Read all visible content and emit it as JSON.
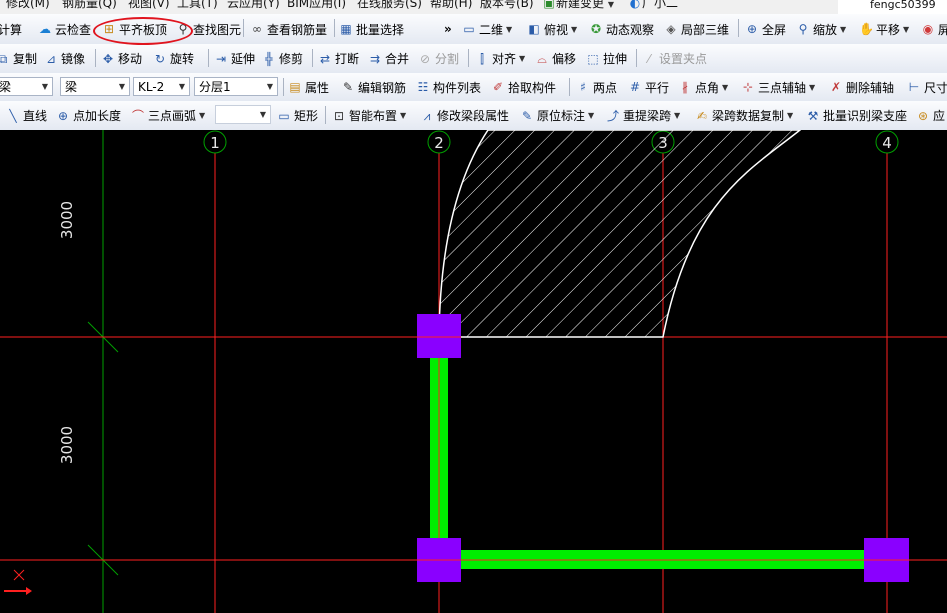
{
  "menubar": {
    "items": [
      "修改(M)",
      "钢筋量(Q)",
      "视图(V)",
      "工具(T)",
      "云应用(Y)",
      "BIM应用(I)",
      "在线服务(S)",
      "帮助(H)",
      "版本号(B)",
      "新建变更",
      "广小二"
    ],
    "user": "fengc50399"
  },
  "toolbar1": {
    "items": [
      "汇总计算",
      "云检查",
      "平齐板顶",
      "查找图元",
      "查看钢筋量",
      "批量选择",
      "二维",
      "俯视",
      "动态观察",
      "局部三维",
      "全屏",
      "缩放",
      "平移",
      "屏"
    ]
  },
  "toolbar2": {
    "items": [
      "复制",
      "镜像",
      "移动",
      "旋转",
      "延伸",
      "修剪",
      "打断",
      "合并",
      "分割",
      "对齐",
      "偏移",
      "拉伸",
      "设置夹点"
    ]
  },
  "toolbar3": {
    "combo_type": "梁",
    "combo_category": "梁",
    "combo_component": "KL-2",
    "combo_layer": "分层1",
    "items": [
      "属性",
      "编辑钢筋",
      "构件列表",
      "拾取构件",
      "两点",
      "平行",
      "点角",
      "三点辅轴",
      "删除辅轴",
      "尺寸"
    ]
  },
  "toolbar4": {
    "items": [
      "直线",
      "点加长度",
      "三点画弧",
      "矩形",
      "智能布置",
      "修改梁段属性",
      "原位标注",
      "重提梁跨",
      "梁跨数据复制",
      "批量识别梁支座",
      "应"
    ]
  },
  "canvas": {
    "axis_labels": [
      "1",
      "2",
      "3",
      "4"
    ],
    "dimension_labels": [
      "3000",
      "3000"
    ],
    "colors": {
      "background": "#000000",
      "axis_line": "#ff2020",
      "dimension_line": "#00c000",
      "beam": "#00ee00",
      "column": "#8a00ff",
      "slab_outline": "#ffffff",
      "highlight": "#e0141e"
    }
  }
}
